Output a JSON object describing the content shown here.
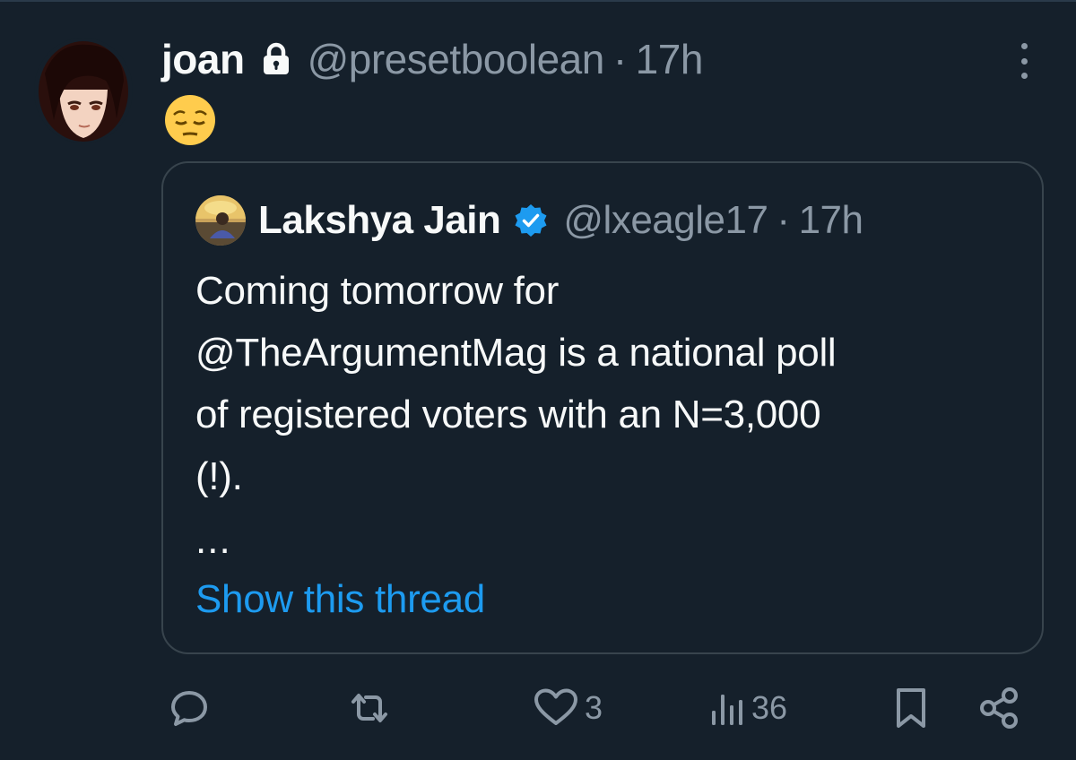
{
  "tweet": {
    "author_name": "joan",
    "author_handle": "@presetboolean",
    "separator": "·",
    "time": "17h",
    "body_emoji": "😌",
    "icons": {
      "lock": "lock-icon",
      "more": "more-options-icon"
    }
  },
  "quoted_tweet": {
    "author_name": "Lakshya Jain",
    "author_handle": "@lxeagle17",
    "separator": "·",
    "time": "17h",
    "verified": true,
    "body_lines": [
      "Coming tomorrow for",
      "@TheArgumentMag is a national poll",
      "of registered voters with an N=3,000",
      "(!)."
    ],
    "ellipsis": "...",
    "show_thread_label": "Show this thread"
  },
  "actions": {
    "reply": {
      "icon": "reply-icon",
      "count": ""
    },
    "retweet": {
      "icon": "retweet-icon",
      "count": ""
    },
    "like": {
      "icon": "heart-icon",
      "count": "3"
    },
    "views": {
      "icon": "views-chart-icon",
      "count": "36"
    },
    "bookmark": {
      "icon": "bookmark-icon"
    },
    "share": {
      "icon": "share-icon"
    }
  },
  "colors": {
    "background": "#15202b",
    "primary_text": "#f7f9f9",
    "secondary_text": "#8b98a5",
    "link": "#1d9bf0",
    "border": "#38444d",
    "verified": "#1d9bf0"
  }
}
